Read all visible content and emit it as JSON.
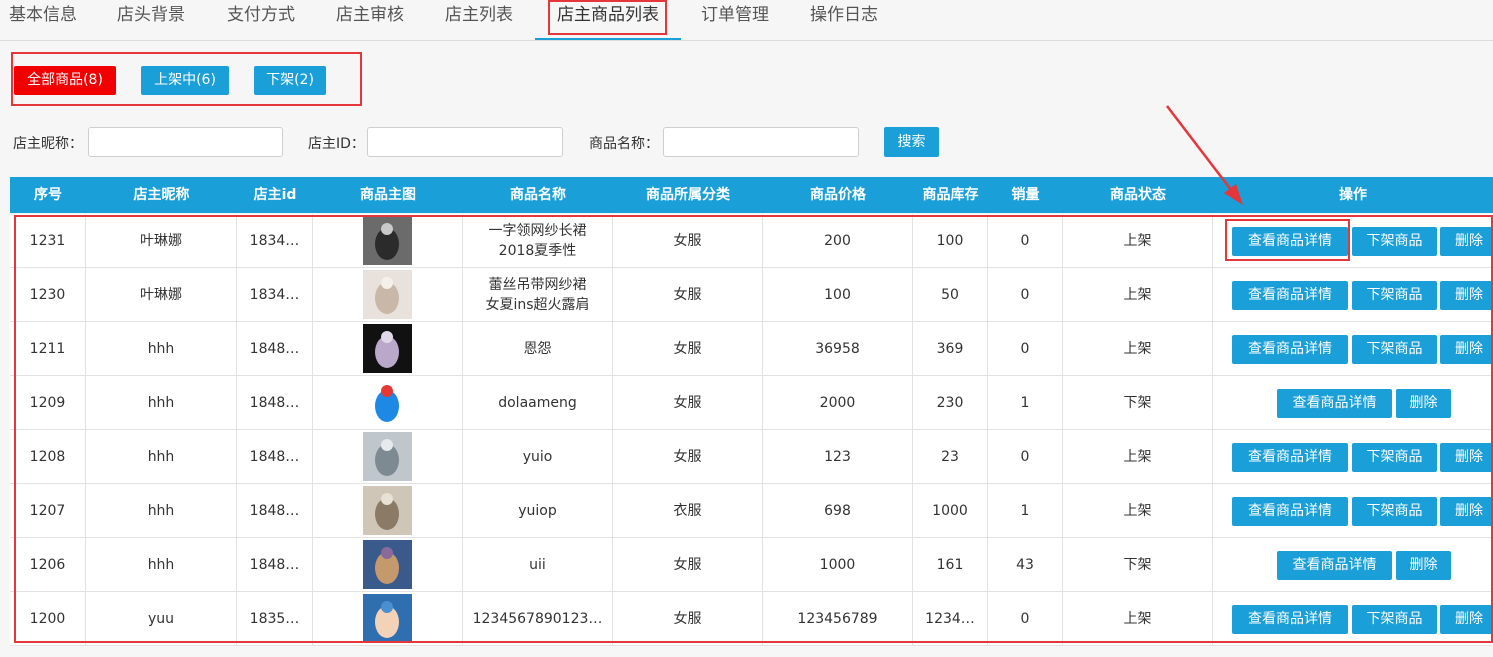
{
  "tabs": [
    "基本信息",
    "店头背景",
    "支付方式",
    "店主审核",
    "店主列表",
    "店主商品列表",
    "订单管理",
    "操作日志"
  ],
  "filters": {
    "all": "全部商品(8)",
    "on_shelf": "上架中(6)",
    "off_shelf": "下架(2)",
    "colors": {
      "all": "#f00000",
      "others": "#1a9fd8"
    }
  },
  "search": {
    "nickname_label": "店主昵称：",
    "id_label": "店主ID：",
    "product_label": "商品名称：",
    "button": "搜索"
  },
  "table": {
    "headers": [
      "序号",
      "店主昵称",
      "店主id",
      "商品主图",
      "商品名称",
      "商品所属分类",
      "商品价格",
      "商品库存",
      "销量",
      "商品状态",
      "操作"
    ],
    "rows": [
      {
        "no": "1231",
        "nick": "叶琳娜",
        "sid": "1834…",
        "name": "一字领网纱长裙\n2018夏季性",
        "cat": "女服",
        "price": "200",
        "stock": "100",
        "sales": "0",
        "status": "上架",
        "actions": [
          "查看商品详情",
          "下架商品",
          "删除"
        ],
        "thumb": "woman-dress-photo"
      },
      {
        "no": "1230",
        "nick": "叶琳娜",
        "sid": "1834…",
        "name": "蕾丝吊带网纱裙\n女夏ins超火露肩",
        "cat": "女服",
        "price": "100",
        "stock": "50",
        "sales": "0",
        "status": "上架",
        "actions": [
          "查看商品详情",
          "下架商品",
          "删除"
        ],
        "thumb": "white-dress-photo"
      },
      {
        "no": "1211",
        "nick": "hhh",
        "sid": "1848…",
        "name": "恩怨",
        "cat": "女服",
        "price": "36958",
        "stock": "369",
        "sales": "0",
        "status": "上架",
        "actions": [
          "查看商品详情",
          "下架商品",
          "删除"
        ],
        "thumb": "flower-dark-photo"
      },
      {
        "no": "1209",
        "nick": "hhh",
        "sid": "1848…",
        "name": "dolaameng",
        "cat": "女服",
        "price": "2000",
        "stock": "230",
        "sales": "1",
        "status": "下架",
        "actions": [
          "查看商品详情",
          "删除"
        ],
        "thumb": "doraemon-photo"
      },
      {
        "no": "1208",
        "nick": "hhh",
        "sid": "1848…",
        "name": "yuio",
        "cat": "女服",
        "price": "123",
        "stock": "23",
        "sales": "0",
        "status": "上架",
        "actions": [
          "查看商品详情",
          "下架商品",
          "删除"
        ],
        "thumb": "room-photo"
      },
      {
        "no": "1207",
        "nick": "hhh",
        "sid": "1848…",
        "name": "yuiop",
        "cat": "衣服",
        "price": "698",
        "stock": "1000",
        "sales": "1",
        "status": "上架",
        "actions": [
          "查看商品详情",
          "下架商品",
          "删除"
        ],
        "thumb": "dancer-photo"
      },
      {
        "no": "1206",
        "nick": "hhh",
        "sid": "1848…",
        "name": "uii",
        "cat": "女服",
        "price": "1000",
        "stock": "161",
        "sales": "43",
        "status": "下架",
        "actions": [
          "查看商品详情",
          "删除"
        ],
        "thumb": "landscape-photo"
      },
      {
        "no": "1200",
        "nick": "yuu",
        "sid": "1835…",
        "name": "1234567890123…",
        "cat": "女服",
        "price": "123456789",
        "stock": "1234…",
        "sales": "0",
        "status": "上架",
        "actions": [
          "查看商品详情",
          "下架商品",
          "删除"
        ],
        "thumb": "child-photo"
      }
    ]
  },
  "colors": {
    "accent": "#1a9fd8",
    "annotation": "#e5363b"
  }
}
